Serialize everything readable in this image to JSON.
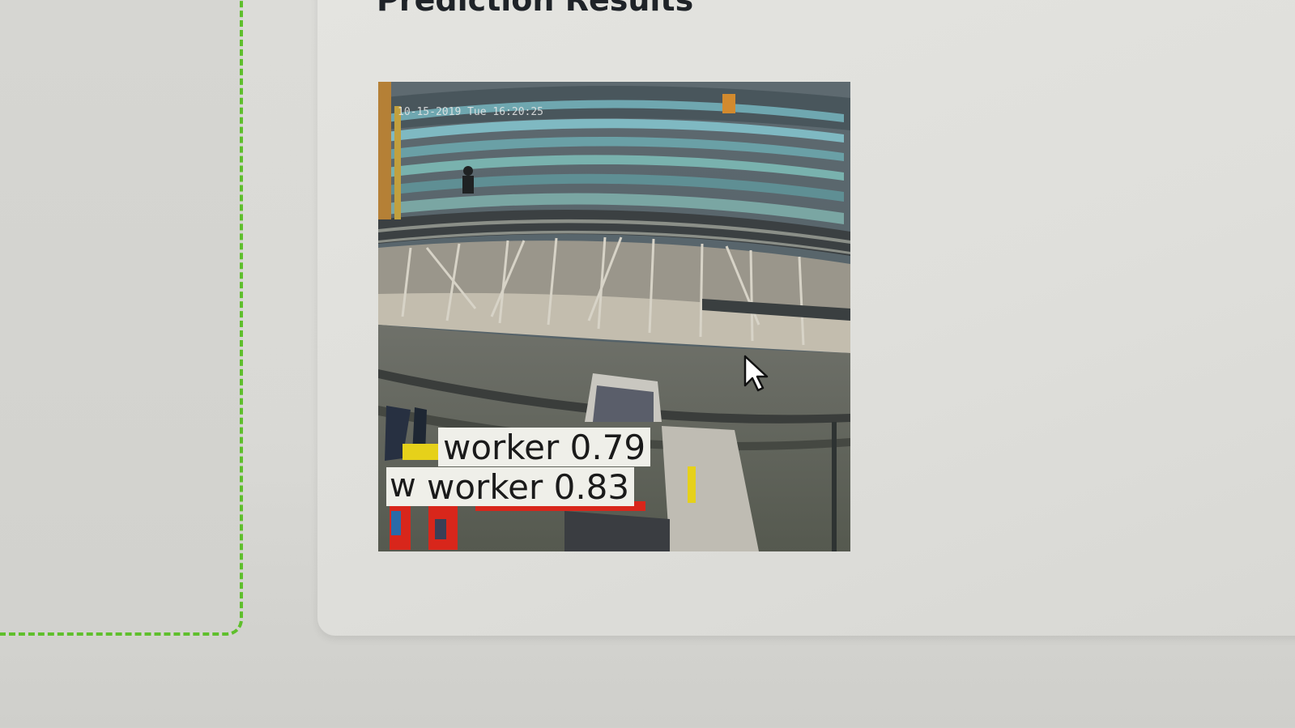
{
  "results": {
    "title": "Prediction Results",
    "image": {
      "timestamp": "10-15-2019 Tue 16:20:25",
      "detections": [
        {
          "label": "worker 0.79"
        },
        {
          "label": "worker 0.83"
        }
      ]
    }
  },
  "colors": {
    "upload_border": "#5fbf2c",
    "box_yellow": "#e6d11a",
    "box_red": "#d8261b",
    "label_bg": "#efefe9"
  },
  "icons": {
    "cursor": "mouse-pointer-icon"
  }
}
